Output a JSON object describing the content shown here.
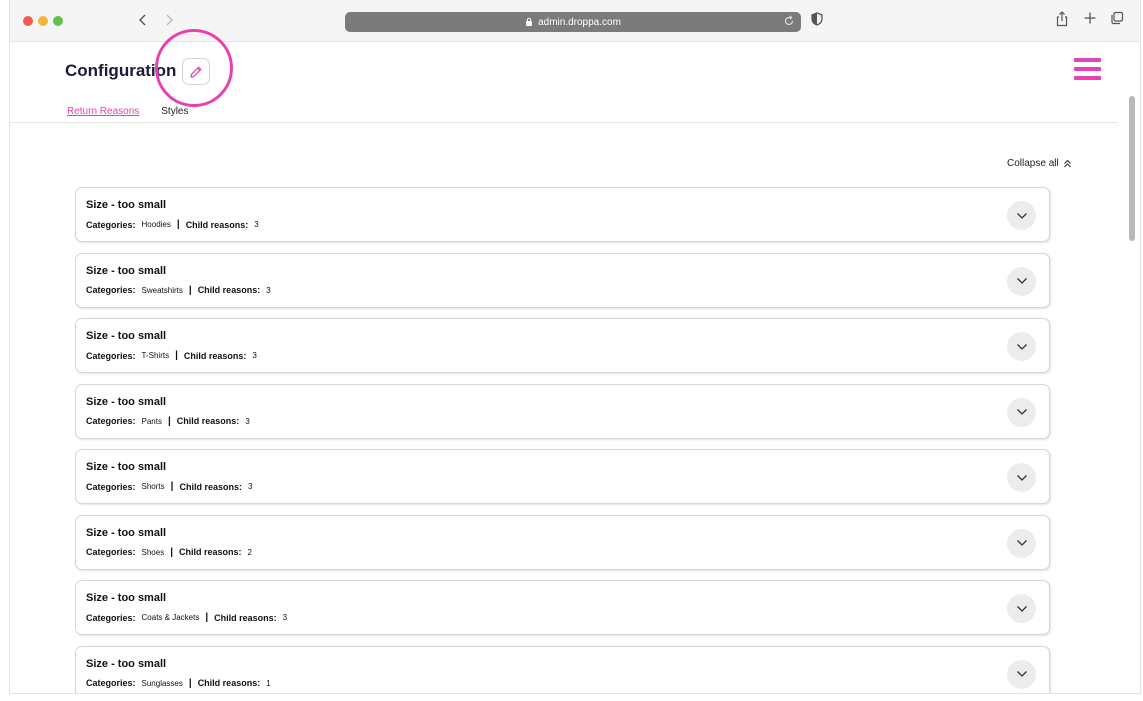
{
  "browser": {
    "url": "admin.droppa.com"
  },
  "page": {
    "title": "Configuration",
    "tabs": [
      {
        "label": "Return Reasons",
        "active": true
      },
      {
        "label": "Styles",
        "active": false
      }
    ],
    "collapse_all_label": "Collapse all",
    "categories_label": "Categories:",
    "child_reasons_label": "Child reasons:",
    "separator": "|"
  },
  "colors": {
    "accent": "#e83fb3",
    "title": "#1b1b3a"
  },
  "reasons": [
    {
      "title": "Size - too small",
      "category": "Hoodies",
      "child_reasons": "3"
    },
    {
      "title": "Size - too small",
      "category": "Sweatshirts",
      "child_reasons": "3"
    },
    {
      "title": "Size - too small",
      "category": "T-Shirts",
      "child_reasons": "3"
    },
    {
      "title": "Size - too small",
      "category": "Pants",
      "child_reasons": "3"
    },
    {
      "title": "Size - too small",
      "category": "Shorts",
      "child_reasons": "3"
    },
    {
      "title": "Size - too small",
      "category": "Shoes",
      "child_reasons": "2"
    },
    {
      "title": "Size - too small",
      "category": "Coats & Jackets",
      "child_reasons": "3"
    },
    {
      "title": "Size - too small",
      "category": "Sunglasses",
      "child_reasons": "1"
    }
  ]
}
